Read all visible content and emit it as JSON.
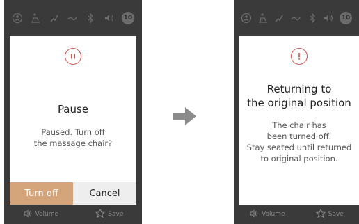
{
  "left_screen": {
    "status_icons": [
      "person-icon",
      "recline-icon",
      "leg-icon",
      "wave-icon",
      "bluetooth-icon",
      "speaker-icon"
    ],
    "timer_badge": "10",
    "dialog": {
      "icon": "pause-icon",
      "title": "Pause",
      "message_line1": "Paused. Turn off",
      "message_line2": "the massage chair?",
      "primary_button": "Turn off",
      "secondary_button": "Cancel"
    },
    "bottom_bar": {
      "volume_label": "Volume",
      "save_label": "Save"
    }
  },
  "right_screen": {
    "status_icons": [
      "person-icon",
      "recline-icon",
      "leg-icon",
      "wave-icon",
      "bluetooth-icon",
      "speaker-icon"
    ],
    "timer_badge": "10",
    "dialog": {
      "icon": "exclamation-icon",
      "title_line1": "Returning to",
      "title_line2": "the original position",
      "message_line1": "The chair has",
      "message_line2": "been turned off.",
      "message_line3": "Stay seated until returned",
      "message_line4": "to original position."
    },
    "bottom_bar": {
      "volume_label": "Volume",
      "save_label": "Save"
    }
  },
  "colors": {
    "device_bg": "#3a3a3a",
    "accent_orange": "#d4a57a",
    "alert_red": "#d9534f",
    "arrow_gray": "#8c8c8c"
  }
}
